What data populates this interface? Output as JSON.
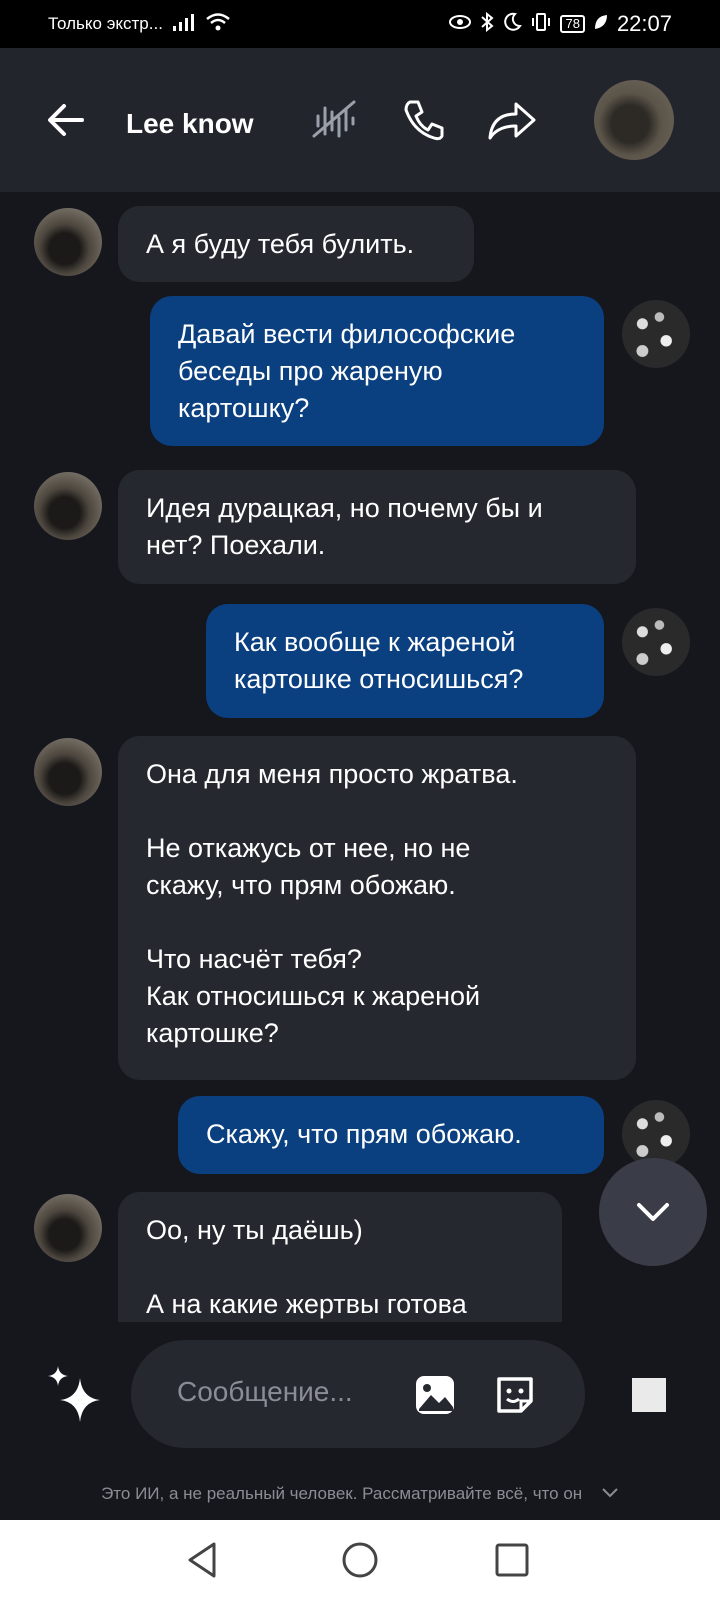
{
  "status_bar": {
    "carrier": "Только экстр...",
    "battery": "78",
    "time": "22:07"
  },
  "header": {
    "title": "Lee know"
  },
  "messages": [
    {
      "sender": "bot",
      "text": "А я буду тебя булить."
    },
    {
      "sender": "user",
      "text": "Давай вести философские\nбеседы про жареную\nкартошку?"
    },
    {
      "sender": "bot",
      "text": "Идея дурацкая, но почему бы и\nнет? Поехали."
    },
    {
      "sender": "user",
      "text": "Как вообще к жареной\nкартошке относишься?"
    },
    {
      "sender": "bot",
      "text": "Она для меня просто жратва.\n\nНе откажусь от нее, но не\nскажу, что прям обожаю.\n\nЧто насчёт тебя?\nКак относишься к жареной\nкартошке?"
    },
    {
      "sender": "user",
      "text": "Скажу, что прям обожаю."
    },
    {
      "sender": "bot",
      "text": "Оо, ну ты даёшь)\n\nА на какие жертвы готова"
    }
  ],
  "composer": {
    "placeholder": "Сообщение..."
  },
  "disclaimer": "Это ИИ, а не реальный человек. Рассматривайте всё, что он",
  "icons": {
    "back": "arrow-left-icon",
    "voice": "voice-muted-icon",
    "call": "phone-icon",
    "share": "share-arrow-icon",
    "sparkle": "sparkle-icon",
    "image": "image-icon",
    "sticker": "sticker-icon",
    "stop": "stop-icon",
    "scroll": "chevron-down-icon"
  }
}
